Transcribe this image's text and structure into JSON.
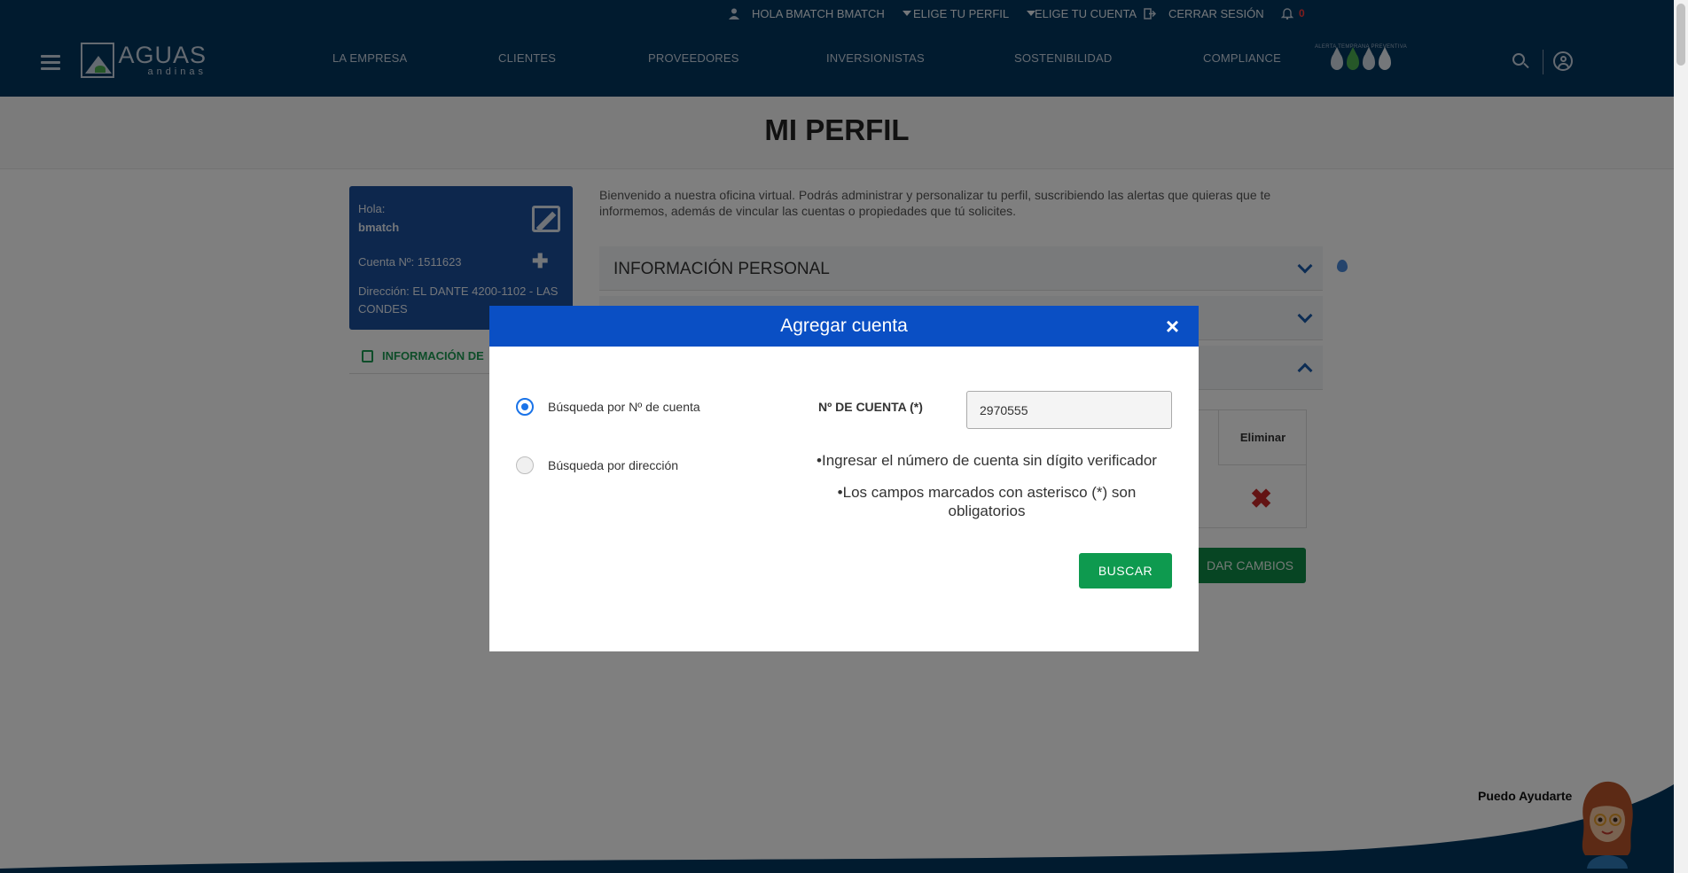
{
  "header": {
    "greeting": "HOLA BMATCH BMATCH",
    "choose_profile": "ELIGE TU PERFIL",
    "choose_account": "ELIGE TU CUENTA",
    "logout": "CERRAR SESIÓN",
    "notification_count": "0",
    "logo_main": "AGUAS",
    "logo_sub": "andinas",
    "nav": [
      "LA EMPRESA",
      "CLIENTES",
      "PROVEEDORES",
      "INVERSIONISTAS",
      "SOSTENIBILIDAD",
      "COMPLIANCE"
    ],
    "alert_caption": "ALERTA TEMPRANA PREVENTIVA",
    "alert_colors": [
      "#cfd8e3",
      "#4caf50",
      "#f2c230",
      "#e8eef5"
    ]
  },
  "page": {
    "title": "MI PERFIL",
    "intro": "Bienvenido a nuestra oficina virtual. Podrás administrar y personalizar tu perfil, suscribiendo las alertas que quieras que te informemos, además de vincular las cuentas o propiedades que tú solicites."
  },
  "profile_card": {
    "hello": "Hola:",
    "user": "bmatch",
    "account": "Cuenta Nº: 1511623",
    "address": "Dirección: EL DANTE 4200-1102 - LAS CONDES",
    "side_link": "INFORMACIÓN DE"
  },
  "accordion": {
    "personal_info": "INFORMACIÓN PERSONAL"
  },
  "table": {
    "col_delete": "Eliminar"
  },
  "save_button": "DAR CAMBIOS",
  "modal": {
    "title": "Agregar cuenta",
    "close": "×",
    "radio_account": "Búsqueda por Nº de cuenta",
    "radio_address": "Búsqueda por dirección",
    "field_label": "Nº DE CUENTA (*)",
    "field_value": "2970555",
    "note_1": "•Ingresar el número de cuenta sin dígito verificador",
    "note_2": "•Los campos marcados con asterisco (*) son obligatorios",
    "search_button": "BUSCAR"
  },
  "assistant": {
    "label": "Puedo Ayudarte"
  },
  "colors": {
    "header": "#03365f",
    "modal_header": "#0a4fc4",
    "primary_green": "#0e9a4f"
  }
}
